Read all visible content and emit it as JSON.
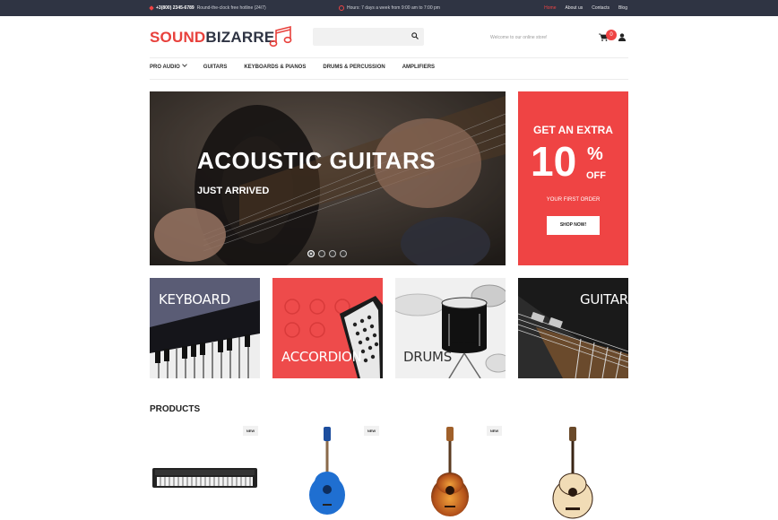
{
  "topbar": {
    "phone": "+3(800) 2345-6789",
    "hotline": "Round-the-clock free hotline (24/7)",
    "hours": "Hours: 7 days a week from 9:00 am to 7:00 pm",
    "links": [
      "Home",
      "About us",
      "Contacts",
      "Blog"
    ],
    "active_link": "Home"
  },
  "header": {
    "logo_part1": "SOUND",
    "logo_part2": "BIZARRE",
    "search_placeholder": "",
    "welcome": "Welcome to our online store!",
    "cart_count": "0"
  },
  "nav": {
    "items": [
      "PRO AUDIO",
      "GUITARS",
      "KEYBOARDS & PIANOS",
      "DRUMS & PERCUSSION",
      "AMPLIFIERS"
    ]
  },
  "hero": {
    "title": "ACOUSTIC GUITARS",
    "subtitle": "JUST ARRIVED",
    "slides": 4,
    "active_slide": 1
  },
  "promo": {
    "line1": "GET AN EXTRA",
    "big": "10",
    "pct": "%",
    "off": "OFF",
    "line3": "YOUR FIRST ORDER",
    "button": "SHOP NOW!"
  },
  "categories": [
    "KEYBOARD",
    "ACCORDION",
    "DRUMS",
    "GUITAR"
  ],
  "products": {
    "title": "PRODUCTS",
    "badge": "NEW"
  },
  "colors": {
    "accent": "#ef4444",
    "topbar": "#2f3443",
    "dark_text": "#2f3443"
  }
}
